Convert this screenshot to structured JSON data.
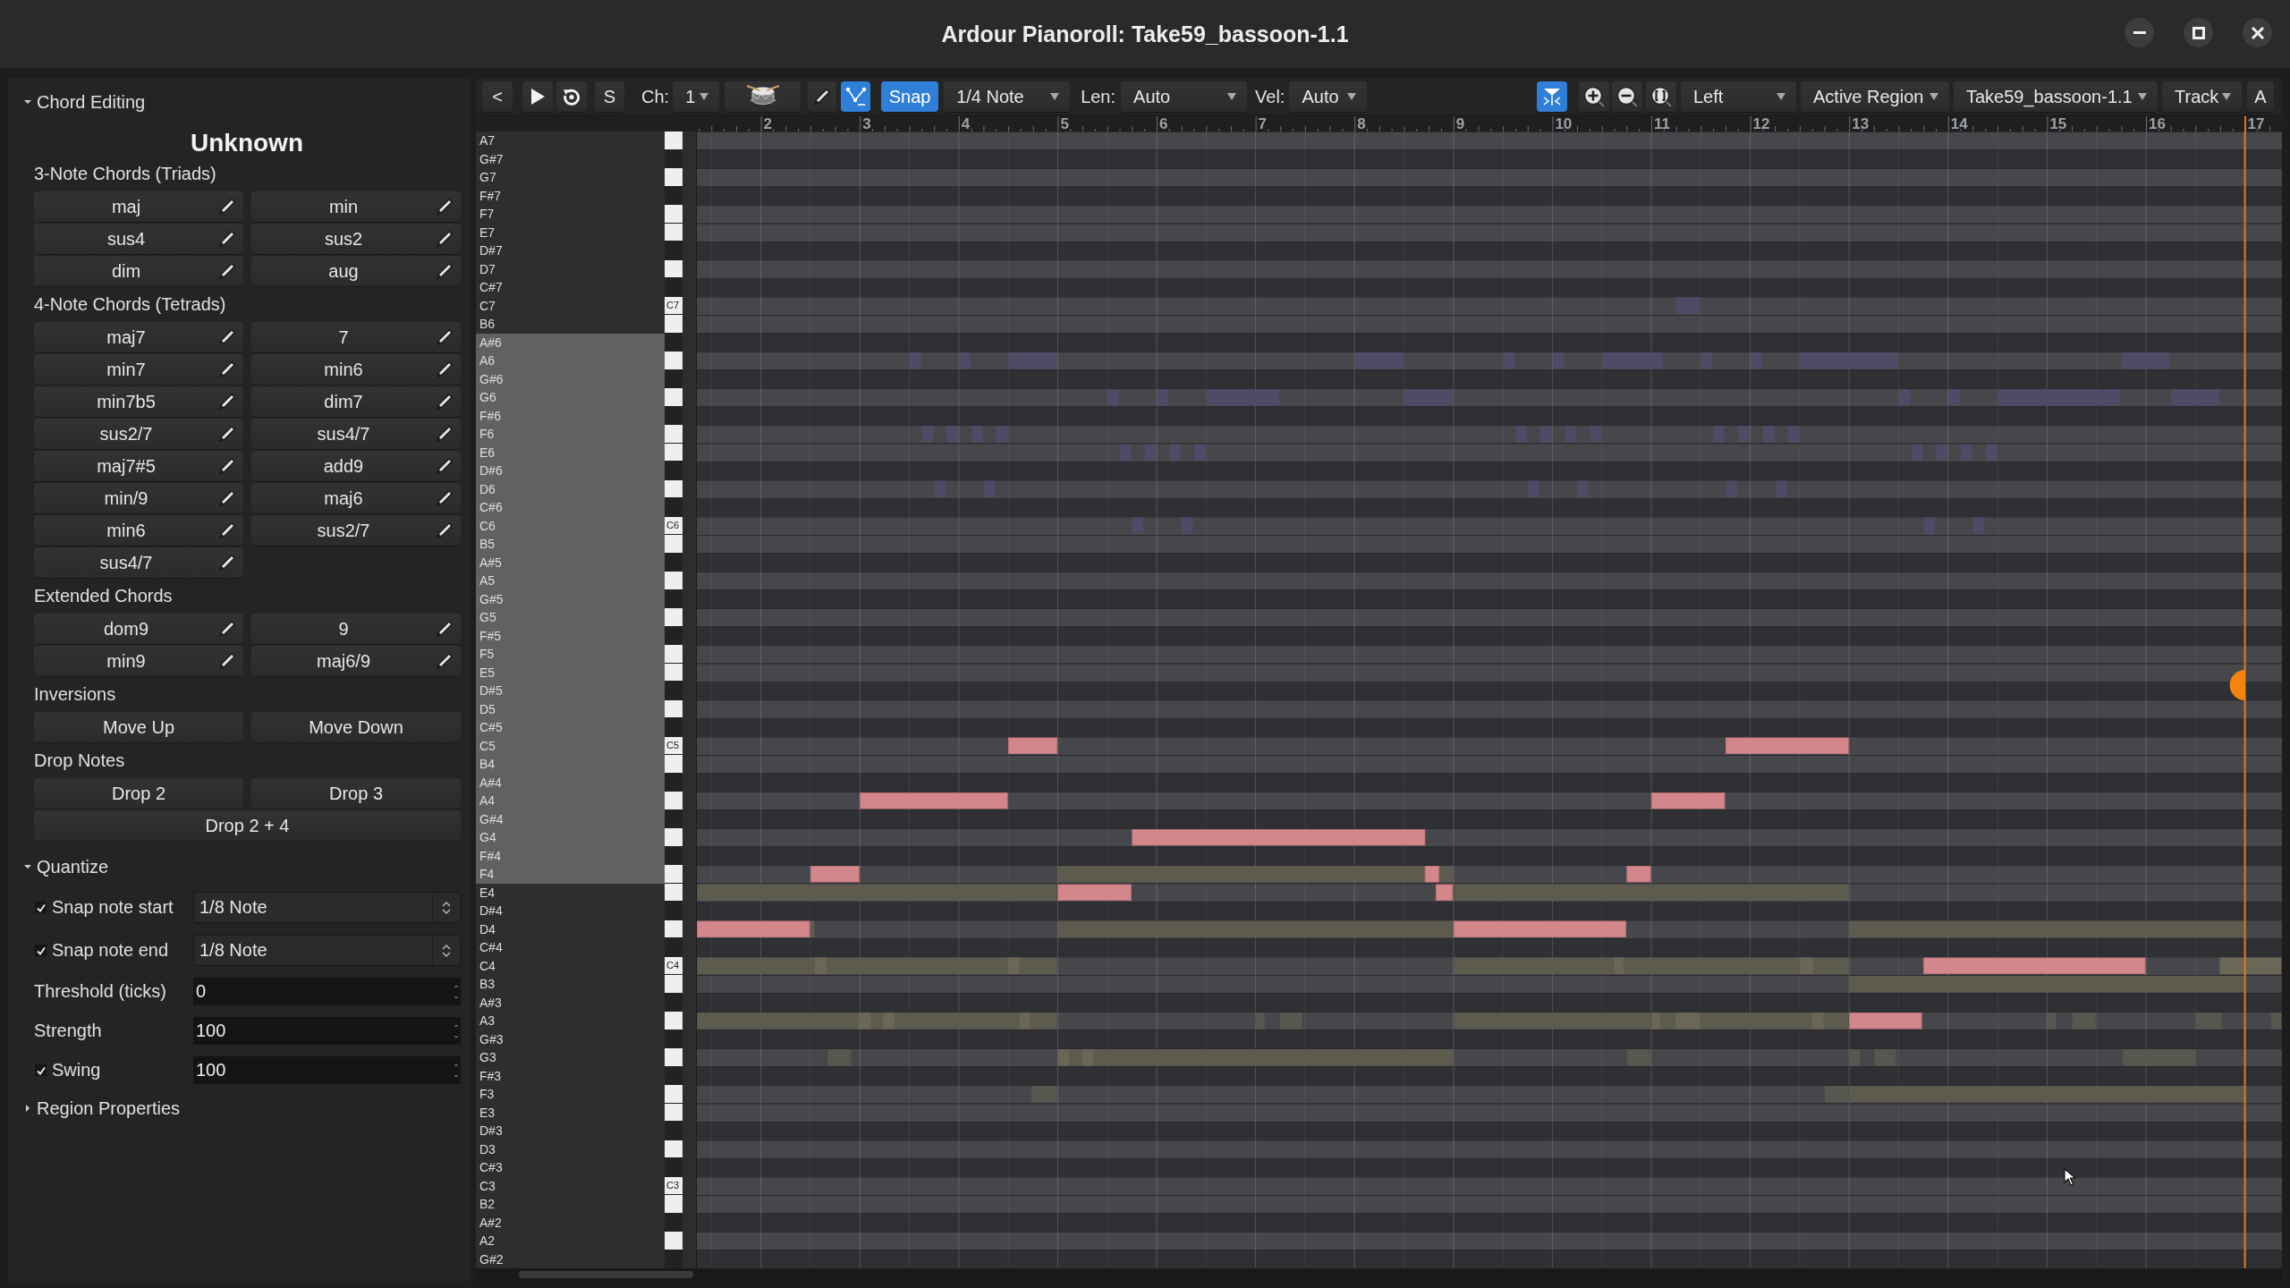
{
  "window": {
    "title": "Ardour Pianoroll: Take59_bassoon-1.1"
  },
  "chord_editing": {
    "label": "Chord Editing",
    "expanded": true,
    "chord_name": "Unknown",
    "groups": [
      {
        "label": "3-Note Chords (Triads)",
        "kind": "chords",
        "buttons": [
          "maj",
          "min",
          "sus4",
          "sus2",
          "dim",
          "aug"
        ]
      },
      {
        "label": "4-Note Chords (Tetrads)",
        "kind": "chords",
        "buttons": [
          "maj7",
          "7",
          "min7",
          "min6",
          "min7b5",
          "dim7",
          "sus2/7",
          "sus4/7",
          "maj7#5",
          "add9",
          "min/9",
          "maj6",
          "min6",
          "sus2/7",
          "sus4/7"
        ]
      },
      {
        "label": "Extended Chords",
        "kind": "chords",
        "buttons": [
          "dom9",
          "9",
          "min9",
          "maj6/9"
        ]
      },
      {
        "label": "Inversions",
        "kind": "actions",
        "buttons": [
          "Move Up",
          "Move Down"
        ]
      },
      {
        "label": "Drop Notes",
        "kind": "actions",
        "buttons": [
          "Drop 2",
          "Drop 3",
          "Drop 2 + 4"
        ]
      }
    ]
  },
  "quantize": {
    "label": "Quantize",
    "expanded": true,
    "rows": [
      {
        "kind": "checkbox_select",
        "label": "Snap note start",
        "checked": true,
        "value": "1/8 Note"
      },
      {
        "kind": "checkbox_select",
        "label": "Snap note end",
        "checked": true,
        "value": "1/8 Note"
      },
      {
        "kind": "spin",
        "label": "Threshold (ticks)",
        "value": "0"
      },
      {
        "kind": "spin",
        "label": "Strength",
        "value": "100"
      },
      {
        "kind": "checkbox_spin",
        "label": "Swing",
        "checked": true,
        "value": "100"
      }
    ]
  },
  "region_properties": {
    "label": "Region Properties",
    "expanded": false
  },
  "toolbar": {
    "back_button": {
      "label": "<"
    },
    "play_button": {
      "active": false
    },
    "loop_button": {
      "active": false
    },
    "s_button": {
      "label": "S",
      "active": false
    },
    "channel": {
      "label": "Ch:",
      "value": "1"
    },
    "drum_button": {
      "active": false
    },
    "draw_button": {
      "active": false
    },
    "edit_button": {
      "active": true
    },
    "snap_button": {
      "label": "Snap",
      "active": true
    },
    "grid_type": {
      "value": "1/4 Note"
    },
    "note_length": {
      "label": "Len:",
      "value": "Auto"
    },
    "note_velocity": {
      "label": "Vel:",
      "value": "Auto"
    },
    "follow_button": {
      "active": true
    },
    "dropdowns": [
      {
        "value": "Left"
      },
      {
        "value": "Active Region"
      },
      {
        "value": "Take59_bassoon-1.1"
      },
      {
        "value": "Track"
      }
    ],
    "a_button": {
      "label": "A"
    }
  },
  "ruler": {
    "bars": [
      "2",
      "3",
      "4",
      "5",
      "6",
      "7",
      "8",
      "9",
      "10",
      "11",
      "12",
      "13",
      "14",
      "15",
      "16",
      "17"
    ]
  },
  "keyboard": {
    "keys": [
      {
        "note": "A7",
        "kind": "white",
        "highlighted": false
      },
      {
        "note": "G#7",
        "kind": "black",
        "highlighted": false
      },
      {
        "note": "G7",
        "kind": "white",
        "highlighted": false
      },
      {
        "note": "F#7",
        "kind": "black",
        "highlighted": false
      },
      {
        "note": "F7",
        "kind": "white",
        "highlighted": false
      },
      {
        "note": "E7",
        "kind": "white",
        "highlighted": false
      },
      {
        "note": "D#7",
        "kind": "black",
        "highlighted": false
      },
      {
        "note": "D7",
        "kind": "white",
        "highlighted": false
      },
      {
        "note": "C#7",
        "kind": "black",
        "highlighted": false
      },
      {
        "note": "C7",
        "kind": "white",
        "highlighted": false,
        "key_label": "C7"
      },
      {
        "note": "B6",
        "kind": "white",
        "highlighted": false
      },
      {
        "note": "A#6",
        "kind": "black",
        "highlighted": true
      },
      {
        "note": "A6",
        "kind": "white",
        "highlighted": true
      },
      {
        "note": "G#6",
        "kind": "black",
        "highlighted": true
      },
      {
        "note": "G6",
        "kind": "white",
        "highlighted": true
      },
      {
        "note": "F#6",
        "kind": "black",
        "highlighted": true
      },
      {
        "note": "F6",
        "kind": "white",
        "highlighted": true
      },
      {
        "note": "E6",
        "kind": "white",
        "highlighted": true
      },
      {
        "note": "D#6",
        "kind": "black",
        "highlighted": true
      },
      {
        "note": "D6",
        "kind": "white",
        "highlighted": true
      },
      {
        "note": "C#6",
        "kind": "black",
        "highlighted": true
      },
      {
        "note": "C6",
        "kind": "white",
        "highlighted": true,
        "key_label": "C6"
      },
      {
        "note": "B5",
        "kind": "white",
        "highlighted": true
      },
      {
        "note": "A#5",
        "kind": "black",
        "highlighted": true
      },
      {
        "note": "A5",
        "kind": "white",
        "highlighted": true
      },
      {
        "note": "G#5",
        "kind": "black",
        "highlighted": true
      },
      {
        "note": "G5",
        "kind": "white",
        "highlighted": true
      },
      {
        "note": "F#5",
        "kind": "black",
        "highlighted": true
      },
      {
        "note": "F5",
        "kind": "white",
        "highlighted": true
      },
      {
        "note": "E5",
        "kind": "white",
        "highlighted": true
      },
      {
        "note": "D#5",
        "kind": "black",
        "highlighted": true
      },
      {
        "note": "D5",
        "kind": "white",
        "highlighted": true
      },
      {
        "note": "C#5",
        "kind": "black",
        "highlighted": true
      },
      {
        "note": "C5",
        "kind": "white",
        "highlighted": true,
        "key_label": "C5"
      },
      {
        "note": "B4",
        "kind": "white",
        "highlighted": true
      },
      {
        "note": "A#4",
        "kind": "black",
        "highlighted": true
      },
      {
        "note": "A4",
        "kind": "white",
        "highlighted": true
      },
      {
        "note": "G#4",
        "kind": "black",
        "highlighted": true
      },
      {
        "note": "G4",
        "kind": "white",
        "highlighted": true
      },
      {
        "note": "F#4",
        "kind": "black",
        "highlighted": true
      },
      {
        "note": "F4",
        "kind": "white",
        "highlighted": true
      },
      {
        "note": "E4",
        "kind": "white",
        "highlighted": false
      },
      {
        "note": "D#4",
        "kind": "black",
        "highlighted": false
      },
      {
        "note": "D4",
        "kind": "white",
        "highlighted": false
      },
      {
        "note": "C#4",
        "kind": "black",
        "highlighted": false
      },
      {
        "note": "C4",
        "kind": "white",
        "highlighted": false,
        "key_label": "C4"
      },
      {
        "note": "B3",
        "kind": "white",
        "highlighted": false
      },
      {
        "note": "A#3",
        "kind": "black",
        "highlighted": false
      },
      {
        "note": "A3",
        "kind": "white",
        "highlighted": false
      },
      {
        "note": "G#3",
        "kind": "black",
        "highlighted": false
      },
      {
        "note": "G3",
        "kind": "white",
        "highlighted": false
      },
      {
        "note": "F#3",
        "kind": "black",
        "highlighted": false
      },
      {
        "note": "F3",
        "kind": "white",
        "highlighted": false
      },
      {
        "note": "E3",
        "kind": "white",
        "highlighted": false
      },
      {
        "note": "D#3",
        "kind": "black",
        "highlighted": false
      },
      {
        "note": "D3",
        "kind": "white",
        "highlighted": false
      },
      {
        "note": "C#3",
        "kind": "black",
        "highlighted": false
      },
      {
        "note": "C3",
        "kind": "white",
        "highlighted": false,
        "key_label": "C3"
      },
      {
        "note": "B2",
        "kind": "white",
        "highlighted": false
      },
      {
        "note": "A#2",
        "kind": "black",
        "highlighted": false
      },
      {
        "note": "A2",
        "kind": "white",
        "highlighted": false
      },
      {
        "note": "G#2",
        "kind": "black",
        "highlighted": false
      }
    ]
  }
}
